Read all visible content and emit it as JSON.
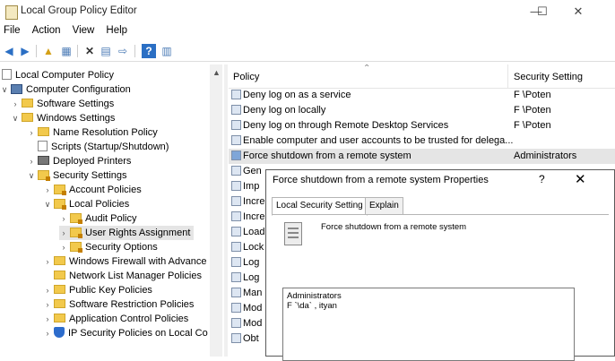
{
  "window": {
    "title": "Local Group Policy Editor",
    "minimize": "—",
    "maximize": "☐",
    "close": "✕"
  },
  "menu": [
    "File",
    "Action",
    "View",
    "Help"
  ],
  "tree": {
    "items": [
      {
        "label": "Local Computer Policy",
        "chevron": "",
        "icon": "policy-icon"
      },
      {
        "label": "Computer Configuration",
        "chevron": "∨",
        "icon": "computer-icon"
      },
      {
        "label": "Software Settings",
        "chevron": "›",
        "icon": "folder-icon"
      },
      {
        "label": "Windows Settings",
        "chevron": "∨",
        "icon": "folder-icon"
      },
      {
        "label": "Name Resolution Policy",
        "chevron": "›",
        "icon": "folder-icon"
      },
      {
        "label": "Scripts (Startup/Shutdown)",
        "chevron": "",
        "icon": "script-icon"
      },
      {
        "label": "Deployed Printers",
        "chevron": "›",
        "icon": "printer-icon"
      },
      {
        "label": "Security Settings",
        "chevron": "∨",
        "icon": "security-icon"
      },
      {
        "label": "Account Policies",
        "chevron": "›",
        "icon": "policy-folder-icon"
      },
      {
        "label": "Local Policies",
        "chevron": "∨",
        "icon": "policy-folder-icon"
      },
      {
        "label": "Audit Policy",
        "chevron": "›",
        "icon": "policy-folder-icon"
      },
      {
        "label": "User Rights Assignment",
        "chevron": "›",
        "icon": "policy-folder-icon"
      },
      {
        "label": "Security Options",
        "chevron": "›",
        "icon": "policy-folder-icon"
      },
      {
        "label": "Windows Firewall with Advance",
        "chevron": "›",
        "icon": "folder-icon"
      },
      {
        "label": "Network List Manager Policies",
        "chevron": "",
        "icon": "folder-icon"
      },
      {
        "label": "Public Key Policies",
        "chevron": "›",
        "icon": "folder-icon"
      },
      {
        "label": "Software Restriction Policies",
        "chevron": "›",
        "icon": "folder-icon"
      },
      {
        "label": "Application Control Policies",
        "chevron": "›",
        "icon": "folder-icon"
      },
      {
        "label": "IP Security Policies on Local Co",
        "chevron": "›",
        "icon": "shield-icon"
      }
    ]
  },
  "list": {
    "col_policy": "Policy",
    "col_setting": "Security Setting",
    "rows": [
      {
        "policy": "Deny log on as a service",
        "setting": "F          \\Poten"
      },
      {
        "policy": "Deny log on locally",
        "setting": "F          \\Poten"
      },
      {
        "policy": "Deny log on through Remote Desktop Services",
        "setting": "F          \\Poten"
      },
      {
        "policy": "Enable computer and user accounts to be trusted for delega...",
        "setting": ""
      },
      {
        "policy": "Force shutdown from a remote system",
        "setting": "Administrators"
      },
      {
        "policy": "Gen",
        "setting": ""
      },
      {
        "policy": "Imp",
        "setting": ""
      },
      {
        "policy": "Incre",
        "setting": ""
      },
      {
        "policy": "Incre",
        "setting": ""
      },
      {
        "policy": "Load",
        "setting": ""
      },
      {
        "policy": "Lock",
        "setting": ""
      },
      {
        "policy": "Log",
        "setting": ""
      },
      {
        "policy": "Log",
        "setting": ""
      },
      {
        "policy": "Man",
        "setting": ""
      },
      {
        "policy": "Mod",
        "setting": ""
      },
      {
        "policy": "Mod",
        "setting": ""
      },
      {
        "policy": "Obt",
        "setting": ""
      }
    ]
  },
  "dialog": {
    "title": "Force shutdown from a remote system Properties",
    "help": "?",
    "close": "✕",
    "tabs": [
      "Local Security Setting",
      "Explain"
    ],
    "policy_name": "Force shutdown from a remote system",
    "members": [
      "Administrators",
      "F          `\\da`      ,  ityan"
    ]
  }
}
